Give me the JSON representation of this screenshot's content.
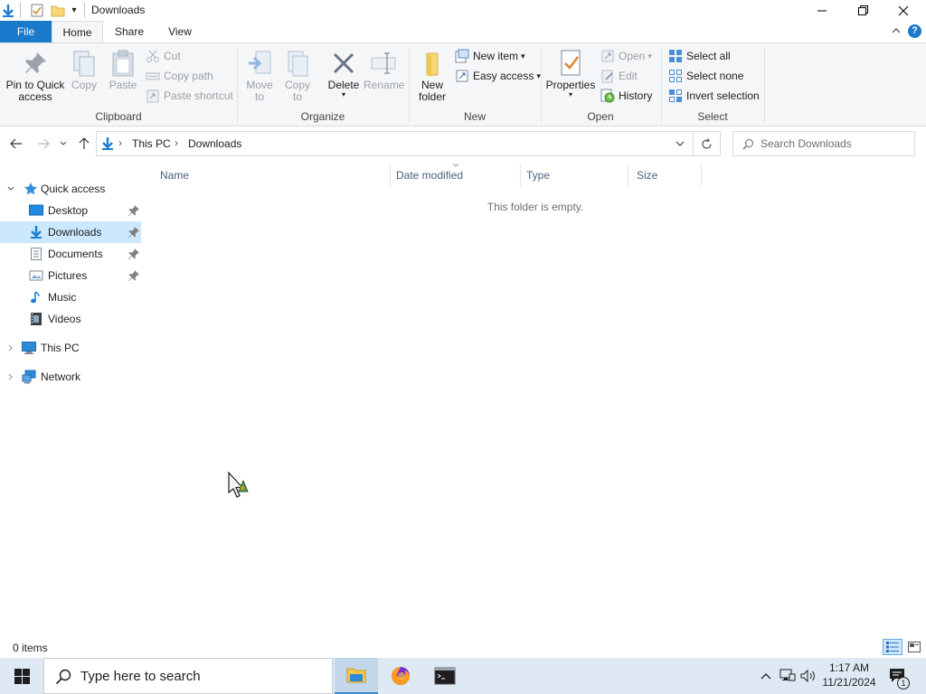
{
  "window": {
    "title": "Downloads",
    "quick_access_dropdown": "▾"
  },
  "ribbon_tabs": {
    "file": "File",
    "home": "Home",
    "share": "Share",
    "view": "View"
  },
  "ribbon": {
    "clipboard": {
      "label": "Clipboard",
      "pin_line1": "Pin to Quick",
      "pin_line2": "access",
      "copy": "Copy",
      "paste": "Paste",
      "cut": "Cut",
      "copy_path": "Copy path",
      "paste_shortcut": "Paste shortcut"
    },
    "organize": {
      "label": "Organize",
      "move_line1": "Move",
      "move_line2": "to",
      "copy_line1": "Copy",
      "copy_line2": "to",
      "delete": "Delete",
      "rename": "Rename"
    },
    "new": {
      "label": "New",
      "new_folder_line1": "New",
      "new_folder_line2": "folder",
      "new_item": "New item",
      "easy_access": "Easy access"
    },
    "open": {
      "label": "Open",
      "properties": "Properties",
      "open": "Open",
      "edit": "Edit",
      "history": "History"
    },
    "select": {
      "label": "Select",
      "select_all": "Select all",
      "select_none": "Select none",
      "invert_selection": "Invert selection"
    }
  },
  "address": {
    "crumbs": [
      "This PC",
      "Downloads"
    ],
    "separator": "›",
    "search_placeholder": "Search Downloads"
  },
  "navpane": {
    "quick_access": "Quick access",
    "items": [
      {
        "label": "Desktop",
        "pinned": true
      },
      {
        "label": "Downloads",
        "pinned": true,
        "selected": true
      },
      {
        "label": "Documents",
        "pinned": true
      },
      {
        "label": "Pictures",
        "pinned": true
      },
      {
        "label": "Music",
        "pinned": false
      },
      {
        "label": "Videos",
        "pinned": false
      }
    ],
    "this_pc": "This PC",
    "network": "Network"
  },
  "columns": [
    "Name",
    "Date modified",
    "Type",
    "Size"
  ],
  "empty_message": "This folder is empty.",
  "status": {
    "item_count": "0 items"
  },
  "taskbar": {
    "search_text": "Type here to search",
    "time": "1:17 AM",
    "date": "11/21/2024",
    "notification_count": "1"
  },
  "colors": {
    "accent": "#1979ca",
    "selection": "#cce8ff",
    "taskbar": "#dfe9f4"
  }
}
